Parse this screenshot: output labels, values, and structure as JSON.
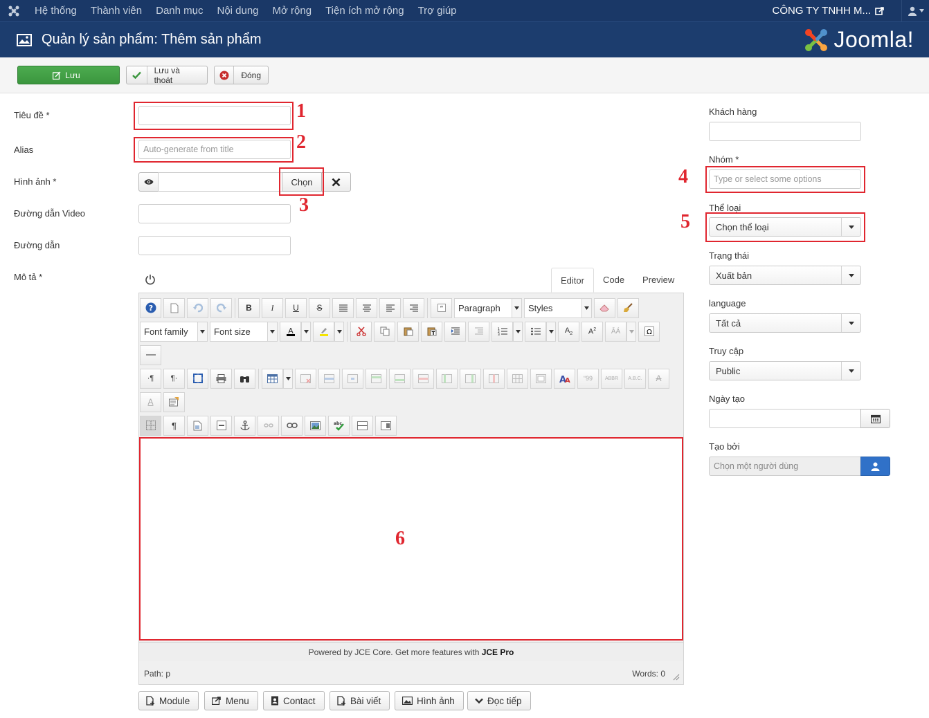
{
  "topnav": {
    "menu": [
      "Hệ thống",
      "Thành viên",
      "Danh mục",
      "Nội dung",
      "Mở rộng",
      "Tiện ích mở rộng",
      "Trợ giúp"
    ],
    "company": "CÔNG TY TNHH M..."
  },
  "titlebar": {
    "title": "Quản lý sản phẩm: Thêm sản phẩm",
    "logo_text": "Joomla!"
  },
  "toolbar": {
    "save_label": "Lưu",
    "save_close_label": "Lưu và thoát",
    "close_label": "Đóng"
  },
  "form": {
    "title_label": "Tiêu đề *",
    "title_value": "",
    "alias_label": "Alias",
    "alias_placeholder": "Auto-generate from title",
    "image_label": "Hình ảnh *",
    "image_value": "",
    "image_select_label": "Chọn",
    "video_label": "Đường dẫn Video",
    "link_label": "Đường dẫn",
    "desc_label": "Mô tả *"
  },
  "editor": {
    "tabs": [
      "Editor",
      "Code",
      "Preview"
    ],
    "active_tab": "Editor",
    "format_select": "Paragraph",
    "styles_select": "Styles",
    "font_family": "Font family",
    "font_size": "Font size",
    "powered_prefix": "Powered by JCE Core. Get more features with ",
    "powered_brand": "JCE Pro",
    "path": "Path: p",
    "words": "Words: 0"
  },
  "xtd_buttons": [
    "Module",
    "Menu",
    "Contact",
    "Bài viết",
    "Hình ảnh",
    "Đọc tiếp"
  ],
  "sidebar": {
    "customer_label": "Khách hàng",
    "group_label": "Nhóm *",
    "group_placeholder": "Type or select some options",
    "category_label": "Thể loại",
    "category_value": "Chọn thể loại",
    "status_label": "Trạng thái",
    "status_value": "Xuất bản",
    "language_label": "language",
    "language_value": "Tất cả",
    "access_label": "Truy cập",
    "access_value": "Public",
    "created_label": "Ngày tạo",
    "created_by_label": "Tạo bởi",
    "created_by_placeholder": "Chọn một người dùng"
  },
  "annotations": [
    "1",
    "2",
    "3",
    "4",
    "5",
    "6"
  ],
  "colors": {
    "nav_bg": "#1a3867",
    "title_bg": "#1c3d6e",
    "save_green": "#43a047",
    "highlight_red": "#e0262f",
    "user_btn_blue": "#3071c8"
  }
}
